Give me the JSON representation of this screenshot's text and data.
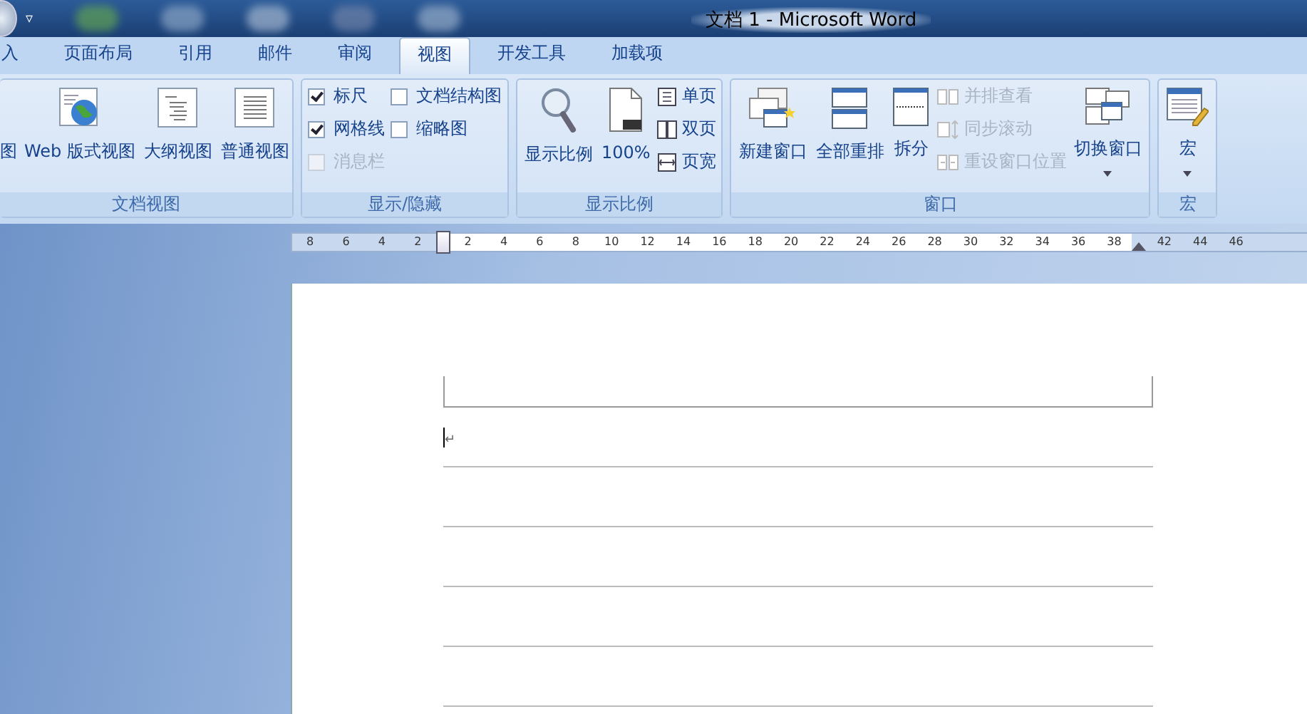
{
  "window": {
    "title": "文档 1 - Microsoft Word",
    "menu_caret": "▿"
  },
  "tabs": [
    {
      "label": "入",
      "selected": false
    },
    {
      "label": "页面布局",
      "selected": false
    },
    {
      "label": "引用",
      "selected": false
    },
    {
      "label": "邮件",
      "selected": false
    },
    {
      "label": "审阅",
      "selected": false
    },
    {
      "label": "视图",
      "selected": true
    },
    {
      "label": "开发工具",
      "selected": false
    },
    {
      "label": "加载项",
      "selected": false
    }
  ],
  "ribbon_groups": [
    {
      "label": "文档视图",
      "columns": [
        [
          {
            "kind": "cut",
            "label": "图",
            "disabled": false
          }
        ],
        [
          {
            "kind": "large",
            "label": "Web 版式视图",
            "disabled": false
          }
        ],
        [
          {
            "kind": "large",
            "label": "大纲视图",
            "disabled": false
          }
        ],
        [
          {
            "kind": "large",
            "label": "普通视图",
            "disabled": false
          }
        ]
      ]
    },
    {
      "label": "显示/隐藏",
      "columns": [
        [
          {
            "kind": "check",
            "label": "标尺",
            "checked": true,
            "disabled": false
          },
          {
            "kind": "check",
            "label": "网格线",
            "checked": true,
            "disabled": false
          },
          {
            "kind": "check",
            "label": "消息栏",
            "checked": false,
            "disabled": true
          }
        ],
        [
          {
            "kind": "check",
            "label": "文档结构图",
            "checked": false,
            "disabled": false
          },
          {
            "kind": "check",
            "label": "缩略图",
            "checked": false,
            "disabled": false
          }
        ]
      ]
    },
    {
      "label": "显示比例",
      "columns": [
        [
          {
            "kind": "large",
            "label": "显示比例",
            "disabled": false
          }
        ],
        [
          {
            "kind": "large",
            "label": "100%",
            "disabled": false
          }
        ],
        [
          {
            "kind": "small",
            "label": "单页",
            "disabled": false
          },
          {
            "kind": "small",
            "label": "双页",
            "disabled": false
          },
          {
            "kind": "small",
            "label": "页宽",
            "disabled": false
          }
        ]
      ]
    },
    {
      "label": "窗口",
      "columns": [
        [
          {
            "kind": "large",
            "label": "新建窗口",
            "disabled": false
          }
        ],
        [
          {
            "kind": "large",
            "label": "全部重排",
            "disabled": false
          }
        ],
        [
          {
            "kind": "large",
            "label": "拆分",
            "disabled": false
          }
        ],
        [
          {
            "kind": "small",
            "label": "并排查看",
            "disabled": true
          },
          {
            "kind": "small",
            "label": "同步滚动",
            "disabled": true
          },
          {
            "kind": "small",
            "label": "重设窗口位置",
            "disabled": true
          }
        ],
        [
          {
            "kind": "dropdown",
            "label": "切换窗口",
            "disabled": false
          }
        ]
      ]
    },
    {
      "label": "宏",
      "columns": [
        [
          {
            "kind": "dropdown",
            "label": "宏",
            "disabled": false
          }
        ]
      ]
    }
  ],
  "ruler": {
    "left_labels": [
      "8",
      "6",
      "4",
      "2"
    ],
    "labels": [
      "2",
      "4",
      "6",
      "8",
      "10",
      "12",
      "14",
      "16",
      "18",
      "20",
      "22",
      "24",
      "26",
      "28",
      "30",
      "32",
      "34",
      "36",
      "38"
    ],
    "right_labels": [
      "42",
      "44",
      "46"
    ]
  },
  "document": {
    "paragraph_mark": "↵"
  }
}
